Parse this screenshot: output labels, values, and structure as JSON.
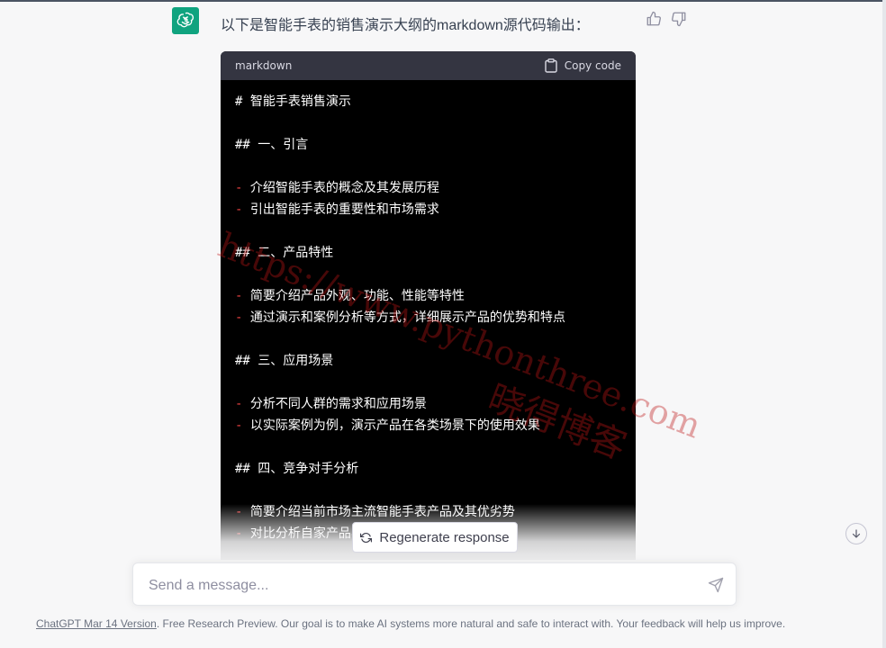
{
  "message": {
    "text": "以下是智能手表的销售演示大纲的markdown源代码输出："
  },
  "code_block": {
    "language": "markdown",
    "copy_label": "Copy code",
    "lines": [
      {
        "prefix": "",
        "text": "# 智能手表销售演示"
      },
      {
        "prefix": "",
        "text": ""
      },
      {
        "prefix": "",
        "text": "## 一、引言"
      },
      {
        "prefix": "",
        "text": ""
      },
      {
        "prefix": "-",
        "text": " 介绍智能手表的概念及其发展历程"
      },
      {
        "prefix": "-",
        "text": " 引出智能手表的重要性和市场需求"
      },
      {
        "prefix": "",
        "text": ""
      },
      {
        "prefix": "",
        "text": "## 二、产品特性"
      },
      {
        "prefix": "",
        "text": ""
      },
      {
        "prefix": "-",
        "text": " 简要介绍产品外观、功能、性能等特性"
      },
      {
        "prefix": "-",
        "text": " 通过演示和案例分析等方式，详细展示产品的优势和特点"
      },
      {
        "prefix": "",
        "text": ""
      },
      {
        "prefix": "",
        "text": "## 三、应用场景"
      },
      {
        "prefix": "",
        "text": ""
      },
      {
        "prefix": "-",
        "text": " 分析不同人群的需求和应用场景"
      },
      {
        "prefix": "-",
        "text": " 以实际案例为例，演示产品在各类场景下的使用效果"
      },
      {
        "prefix": "",
        "text": ""
      },
      {
        "prefix": "",
        "text": "## 四、竞争对手分析"
      },
      {
        "prefix": "",
        "text": ""
      },
      {
        "prefix": "-",
        "text": " 简要介绍当前市场主流智能手表产品及其优劣势"
      },
      {
        "prefix": "-",
        "text": " 对比分析自家产品与竞争对手产品的优势"
      }
    ]
  },
  "watermark": {
    "url": "https://www.pythonthree.com",
    "cn": "晓得博客"
  },
  "regenerate_label": "Regenerate response",
  "input": {
    "placeholder": "Send a message..."
  },
  "footer": {
    "link": "ChatGPT Mar 14 Version",
    "text": ". Free Research Preview. Our goal is to make AI systems more natural and safe to interact with. Your feedback will help us improve."
  },
  "colors": {
    "avatar": "#10a37f",
    "code_bg": "#000000",
    "code_header": "#343541",
    "list_dash": "#ef4444"
  }
}
